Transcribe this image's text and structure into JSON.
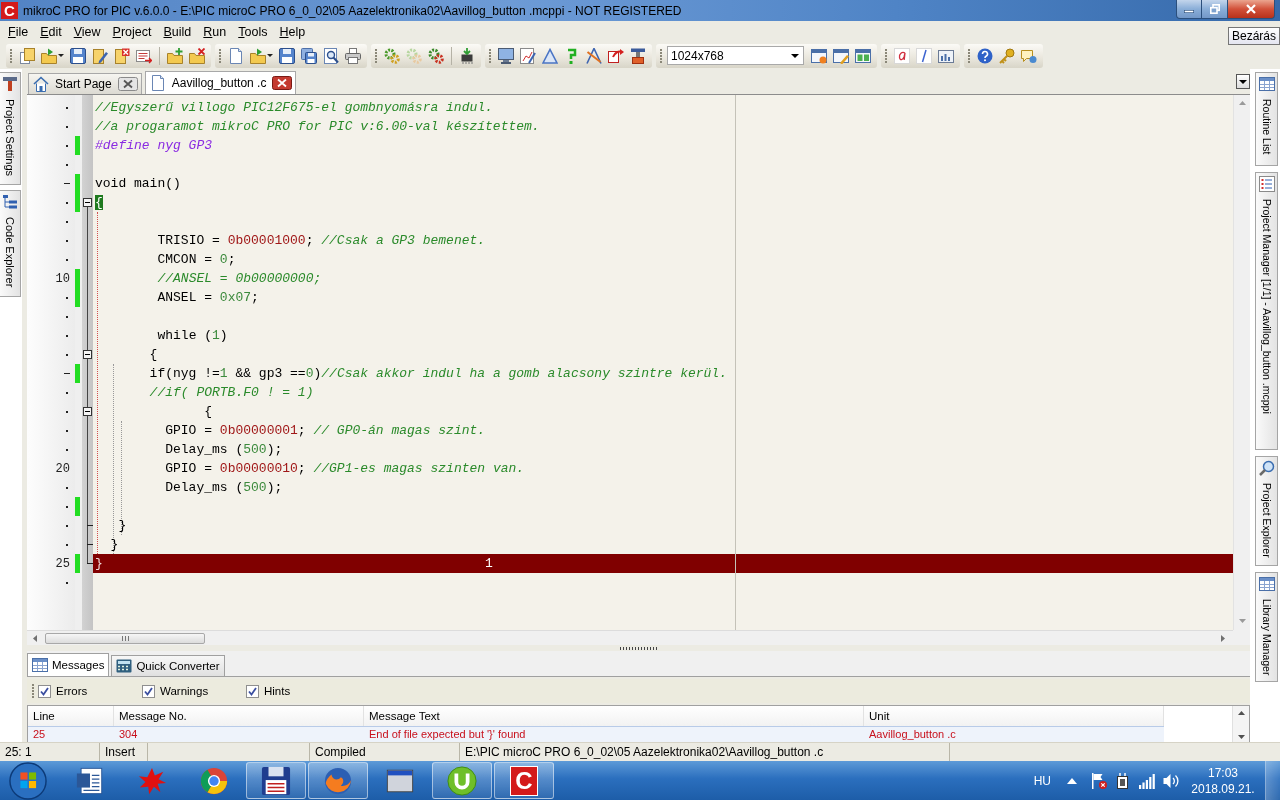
{
  "window": {
    "icon": "C",
    "title": "mikroC PRO for PIC v.6.0.0 - E:\\PIC microC PRO 6_0_02\\05 Aazelektronika02\\Aavillog_button .mcppi - NOT REGISTERED",
    "tooltip": "Bezárás"
  },
  "menu": [
    "File",
    "Edit",
    "View",
    "Project",
    "Build",
    "Run",
    "Tools",
    "Help"
  ],
  "toolbar": {
    "resolution": "1024x768"
  },
  "left_panels": [
    "Project Settings",
    "Code Explorer"
  ],
  "editor_tabs": [
    {
      "label": "Start Page",
      "selected": false
    },
    {
      "label": "Aavillog_button .c",
      "selected": true
    }
  ],
  "editor": {
    "lines": [
      {
        "kind": "dot",
        "modified": false,
        "error": false,
        "fold_start": false,
        "fold_end": false,
        "tokens": [
          {
            "kind": "comment",
            "text": "//Egyszerű villogo PIC12F675-el gombnyomásra indul."
          }
        ]
      },
      {
        "kind": "dot",
        "modified": false,
        "error": false,
        "fold_start": false,
        "fold_end": false,
        "tokens": [
          {
            "kind": "comment",
            "text": "//a progaramot mikroC PRO for PIC v:6.00-val készítettem."
          }
        ]
      },
      {
        "kind": "dot",
        "modified": true,
        "error": false,
        "fold_start": false,
        "fold_end": false,
        "tokens": [
          {
            "kind": "directive",
            "text": "#define nyg GP3"
          }
        ]
      },
      {
        "kind": "dot",
        "modified": false,
        "error": false,
        "fold_start": false,
        "fold_end": false
      },
      {
        "kind": "dash",
        "modified": true,
        "error": false,
        "fold_start": false,
        "fold_end": false,
        "tokens": [
          {
            "kind": "plain",
            "text": "void main()"
          }
        ]
      },
      {
        "kind": "dot",
        "modified": true,
        "error": false,
        "fold_start": true,
        "fold_end": false,
        "tokens": [
          {
            "kind": "match",
            "text": "{"
          }
        ]
      },
      {
        "kind": "dot",
        "modified": false,
        "error": false,
        "fold_start": false,
        "fold_end": false
      },
      {
        "kind": "dot",
        "modified": false,
        "error": false,
        "fold_start": false,
        "fold_end": false,
        "tokens": [
          {
            "kind": "plain",
            "text": "        TRISIO = "
          },
          {
            "kind": "binary",
            "text": "0b00001000"
          },
          {
            "kind": "plain",
            "text": ";"
          },
          {
            "kind": "comment",
            "text": " //Csak a GP3 bemenet."
          }
        ]
      },
      {
        "kind": "dot",
        "modified": false,
        "error": false,
        "fold_start": false,
        "fold_end": false,
        "tokens": [
          {
            "kind": "plain",
            "text": "        CMCON = "
          },
          {
            "kind": "number",
            "text": "0"
          },
          {
            "kind": "plain",
            "text": ";"
          }
        ]
      },
      {
        "kind": "number",
        "number": "10",
        "modified": true,
        "error": false,
        "fold_start": false,
        "fold_end": false,
        "tokens": [
          {
            "kind": "comment",
            "text": "        //ANSEL = 0b00000000;"
          }
        ]
      },
      {
        "kind": "dot",
        "modified": true,
        "error": false,
        "fold_start": false,
        "fold_end": false,
        "tokens": [
          {
            "kind": "plain",
            "text": "        ANSEL = "
          },
          {
            "kind": "number",
            "text": "0x07"
          },
          {
            "kind": "plain",
            "text": ";"
          }
        ]
      },
      {
        "kind": "dot",
        "modified": false,
        "error": false,
        "fold_start": false,
        "fold_end": false
      },
      {
        "kind": "dot",
        "modified": false,
        "error": false,
        "fold_start": false,
        "fold_end": false,
        "tokens": [
          {
            "kind": "plain",
            "text": "        while ("
          },
          {
            "kind": "number",
            "text": "1"
          },
          {
            "kind": "plain",
            "text": ")"
          }
        ]
      },
      {
        "kind": "dot",
        "modified": false,
        "error": false,
        "fold_start": true,
        "fold_end": false,
        "tokens": [
          {
            "kind": "plain",
            "text": "       {"
          }
        ]
      },
      {
        "kind": "dash",
        "modified": true,
        "error": false,
        "fold_start": false,
        "fold_end": false,
        "tokens": [
          {
            "kind": "plain",
            "text": "       if(nyg !="
          },
          {
            "kind": "number",
            "text": "1"
          },
          {
            "kind": "plain",
            "text": " && gp3 =="
          },
          {
            "kind": "number",
            "text": "0"
          },
          {
            "kind": "plain",
            "text": ")"
          },
          {
            "kind": "comment",
            "text": "//Csak akkor indul ha a gomb alacsony szintre kerül."
          }
        ]
      },
      {
        "kind": "dot",
        "modified": false,
        "error": false,
        "fold_start": false,
        "fold_end": false,
        "tokens": [
          {
            "kind": "comment",
            "text": "       //if( PORTB.F0 ! = 1)"
          }
        ]
      },
      {
        "kind": "dot",
        "modified": false,
        "error": false,
        "fold_start": true,
        "fold_end": false,
        "tokens": [
          {
            "kind": "plain",
            "text": "              {"
          }
        ]
      },
      {
        "kind": "dot",
        "modified": false,
        "error": false,
        "fold_start": false,
        "fold_end": false,
        "tokens": [
          {
            "kind": "plain",
            "text": "         GPIO = "
          },
          {
            "kind": "binary",
            "text": "0b00000001"
          },
          {
            "kind": "plain",
            "text": ";"
          },
          {
            "kind": "comment",
            "text": " // GP0-án magas szint."
          }
        ]
      },
      {
        "kind": "dot",
        "modified": false,
        "error": false,
        "fold_start": false,
        "fold_end": false,
        "tokens": [
          {
            "kind": "plain",
            "text": "         Delay_ms ("
          },
          {
            "kind": "number",
            "text": "500"
          },
          {
            "kind": "plain",
            "text": ");"
          }
        ]
      },
      {
        "kind": "number",
        "number": "20",
        "modified": false,
        "error": false,
        "fold_start": false,
        "fold_end": false,
        "tokens": [
          {
            "kind": "plain",
            "text": "         GPIO = "
          },
          {
            "kind": "binary",
            "text": "0b00000010"
          },
          {
            "kind": "plain",
            "text": ";"
          },
          {
            "kind": "comment",
            "text": " //GP1-es magas szinten van."
          }
        ]
      },
      {
        "kind": "dot",
        "modified": false,
        "error": false,
        "fold_start": false,
        "fold_end": false,
        "tokens": [
          {
            "kind": "plain",
            "text": "         Delay_ms ("
          },
          {
            "kind": "number",
            "text": "500"
          },
          {
            "kind": "plain",
            "text": ");"
          }
        ]
      },
      {
        "kind": "dot",
        "modified": true,
        "error": false,
        "fold_start": false,
        "fold_end": false
      },
      {
        "kind": "dot",
        "modified": false,
        "error": false,
        "fold_start": false,
        "fold_end": true,
        "tokens": [
          {
            "kind": "plain",
            "text": "   }"
          }
        ]
      },
      {
        "kind": "dot",
        "modified": false,
        "error": false,
        "fold_start": false,
        "fold_end": true,
        "tokens": [
          {
            "kind": "plain",
            "text": "  }"
          }
        ]
      },
      {
        "kind": "number",
        "number": "25",
        "modified": true,
        "error": true,
        "fold_start": false,
        "fold_end": true,
        "note": "1",
        "tokens": [
          {
            "kind": "plain",
            "text": "}"
          }
        ]
      },
      {
        "kind": "dot",
        "modified": false,
        "error": false,
        "fold_start": false,
        "fold_end": false
      }
    ]
  },
  "right_panels": [
    "Routine List",
    "Project Manager [1/1] - Aavillog_button .mcppi",
    "Project Explorer",
    "Library Manager"
  ],
  "messages_panel": {
    "tabs": [
      {
        "label": "Messages",
        "selected": true
      },
      {
        "label": "Quick Converter",
        "selected": false
      }
    ],
    "filters": [
      {
        "label": "Errors",
        "checked": true
      },
      {
        "label": "Warnings",
        "checked": true
      },
      {
        "label": "Hints",
        "checked": true
      }
    ],
    "columns": [
      "Line",
      "Message No.",
      "Message Text",
      "Unit"
    ],
    "rows": [
      [
        "25",
        "304",
        "End of file expected but '}' found",
        "Aavillog_button .c"
      ]
    ]
  },
  "status_bar": [
    "25: 1",
    "Insert",
    "Compiled",
    "E:\\PIC microC PRO 6_0_02\\05 Aazelektronika02\\Aavillog_button .c"
  ],
  "taskbar": {
    "apps": [
      {
        "kind": "document",
        "running": false
      },
      {
        "kind": "splat",
        "running": false
      },
      {
        "kind": "ring",
        "running": false
      },
      {
        "kind": "floppy",
        "running": true
      },
      {
        "kind": "globe",
        "running": true
      },
      {
        "kind": "window",
        "running": false
      },
      {
        "kind": "badge",
        "running": true
      },
      {
        "kind": "logo",
        "running": true,
        "label": "C"
      }
    ],
    "language": "HU",
    "time": "17:03",
    "date": "2018.09.21."
  }
}
